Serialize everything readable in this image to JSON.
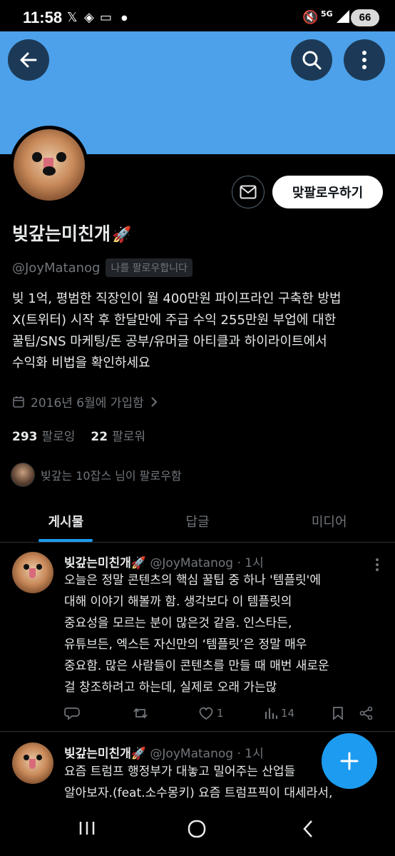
{
  "status_bar": {
    "time": "11:58",
    "battery": "66",
    "network": "5G"
  },
  "profile": {
    "name": "빚갚는미친개",
    "handle": "@JoyMatanog",
    "follows_you_badge": "나를 팔로우합니다",
    "follow_button": "맞팔로우하기",
    "bio_lines": [
      "빚 1억, 평범한 직장인이 월 400만원 파이프라인 구축한 방법",
      "X(트위터) 시작 후 한달만에 주급 수익 255만원 부업에 대한",
      "꿀팁/SNS 마케팅/돈 공부/유머글 아티클과 하이라이트에서",
      "수익화 비법을 확인하세요"
    ],
    "joined": "2016년 6월에 가입함",
    "following_count": "293",
    "following_label": "팔로잉",
    "followers_count": "22",
    "followers_label": "팔로워",
    "followed_by": "빚갚는 10잡스 님이 팔로우함"
  },
  "tabs": [
    {
      "label": "게시물",
      "active": true
    },
    {
      "label": "답글",
      "active": false
    },
    {
      "label": "미디어",
      "active": false
    }
  ],
  "tweets": [
    {
      "name": "빚갚는미친개",
      "handle": "@JoyMatanog",
      "time": "1시",
      "lines": [
        "오늘은 정말 콘텐츠의 핵심 꿀팁 중 하나 '템플릿'에",
        "대해 이야기 해볼까 함.  생각보다 이 템플릿의",
        "중요성을 모르는 분이 많은것 같음.  인스타든,",
        "유튜브든, 엑스든 자신만의 ‘템플릿’은 정말 매우",
        "중요함.  많은 사람들이 콘텐츠를 만들 때 매번 새로운",
        "걸 창조하려고 하는데,  실제로 오래 가는많"
      ],
      "likes": "1",
      "views": "14"
    },
    {
      "name": "빚갚는미친개",
      "handle": "@JoyMatanog",
      "time": "1시",
      "lines": [
        "요즘 트럼프 행정부가 대놓고 밀어주는 산업들",
        "알아보자.(feat.소수몽키)  요즘 트럼프픽이 대세라서,"
      ]
    }
  ],
  "colors": {
    "banner": "#4ca1ea",
    "accent": "#1d9bf0",
    "background": "#000000",
    "muted_text": "#71767b"
  }
}
